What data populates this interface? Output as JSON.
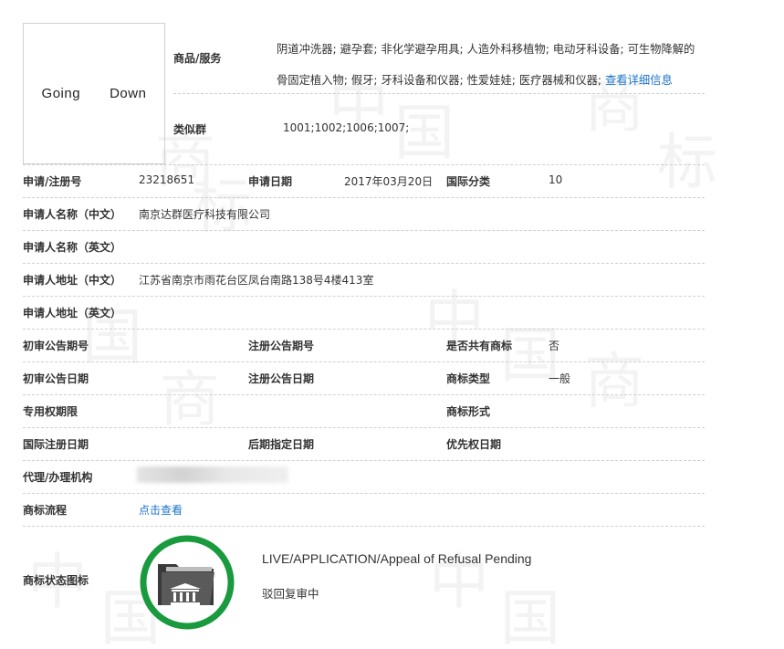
{
  "logo_text": "Going   Down",
  "goods": {
    "label": "商品/服务",
    "value": "阴道冲洗器; 避孕套; 非化学避孕用具; 人造外科移植物; 电动牙科设备; 可生物降解的骨固定植入物; 假牙; 牙科设备和仪器; 性爱娃娃; 医疗器械和仪器;",
    "link": "查看详细信息"
  },
  "similar_group": {
    "label": "类似群",
    "value": "1001;1002;1006;1007;"
  },
  "fields": {
    "reg_no": {
      "label": "申请/注册号",
      "value": "23218651"
    },
    "apply_date": {
      "label": "申请日期",
      "value": "2017年03月20日"
    },
    "intl_class": {
      "label": "国际分类",
      "value": "10"
    },
    "applicant_cn": {
      "label": "申请人名称（中文）",
      "value": "南京达群医疗科技有限公司"
    },
    "applicant_en": {
      "label": "申请人名称（英文）",
      "value": ""
    },
    "address_cn": {
      "label": "申请人地址（中文）",
      "value": "江苏省南京市雨花台区凤台南路138号4楼413室"
    },
    "address_en": {
      "label": "申请人地址（英文）",
      "value": ""
    },
    "prelim_pub_no": {
      "label": "初审公告期号",
      "value": ""
    },
    "reg_pub_no": {
      "label": "注册公告期号",
      "value": ""
    },
    "shared": {
      "label": "是否共有商标",
      "value": "否"
    },
    "prelim_pub_date": {
      "label": "初审公告日期",
      "value": ""
    },
    "reg_pub_date": {
      "label": "注册公告日期",
      "value": ""
    },
    "tm_type": {
      "label": "商标类型",
      "value": "一般"
    },
    "exclusive_term": {
      "label": "专用权期限",
      "value": ""
    },
    "tm_form": {
      "label": "商标形式",
      "value": ""
    },
    "intl_reg_date": {
      "label": "国际注册日期",
      "value": ""
    },
    "later_date": {
      "label": "后期指定日期",
      "value": ""
    },
    "priority_date": {
      "label": "优先权日期",
      "value": ""
    },
    "agent": {
      "label": "代理/办理机构",
      "value": ""
    },
    "flow": {
      "label": "商标流程",
      "link": "点击查看"
    },
    "status": {
      "label": "商标状态图标",
      "en": "LIVE/APPLICATION/Appeal of Refusal Pending",
      "cn": "驳回复审中"
    }
  },
  "watermark": {
    "zhong": "中",
    "guo": "国",
    "shang": "商",
    "biao": "标"
  },
  "icons": {
    "status": "folder-courthouse-icon"
  },
  "colors": {
    "link": "#1a73c7",
    "status_ring": "#1a9a3e",
    "dash": "#cfcfcf"
  }
}
